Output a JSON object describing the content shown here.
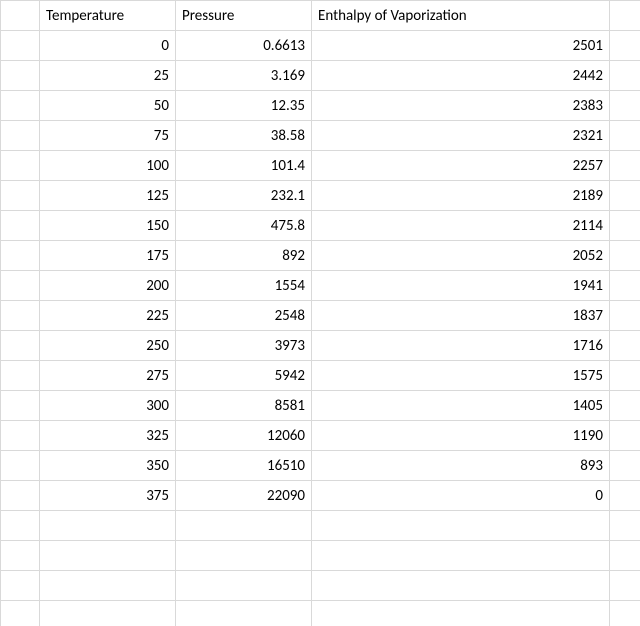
{
  "headers": [
    "Temperature",
    "Pressure",
    "Enthalpy of Vaporization"
  ],
  "rows": [
    {
      "temperature": "0",
      "pressure": "0.6613",
      "enthalpy": "2501"
    },
    {
      "temperature": "25",
      "pressure": "3.169",
      "enthalpy": "2442"
    },
    {
      "temperature": "50",
      "pressure": "12.35",
      "enthalpy": "2383"
    },
    {
      "temperature": "75",
      "pressure": "38.58",
      "enthalpy": "2321"
    },
    {
      "temperature": "100",
      "pressure": "101.4",
      "enthalpy": "2257"
    },
    {
      "temperature": "125",
      "pressure": "232.1",
      "enthalpy": "2189"
    },
    {
      "temperature": "150",
      "pressure": "475.8",
      "enthalpy": "2114"
    },
    {
      "temperature": "175",
      "pressure": "892",
      "enthalpy": "2052"
    },
    {
      "temperature": "200",
      "pressure": "1554",
      "enthalpy": "1941"
    },
    {
      "temperature": "225",
      "pressure": "2548",
      "enthalpy": "1837"
    },
    {
      "temperature": "250",
      "pressure": "3973",
      "enthalpy": "1716"
    },
    {
      "temperature": "275",
      "pressure": "5942",
      "enthalpy": "1575"
    },
    {
      "temperature": "300",
      "pressure": "8581",
      "enthalpy": "1405"
    },
    {
      "temperature": "325",
      "pressure": "12060",
      "enthalpy": "1190"
    },
    {
      "temperature": "350",
      "pressure": "16510",
      "enthalpy": "893"
    },
    {
      "temperature": "375",
      "pressure": "22090",
      "enthalpy": "0"
    }
  ],
  "empty_rows": 4
}
